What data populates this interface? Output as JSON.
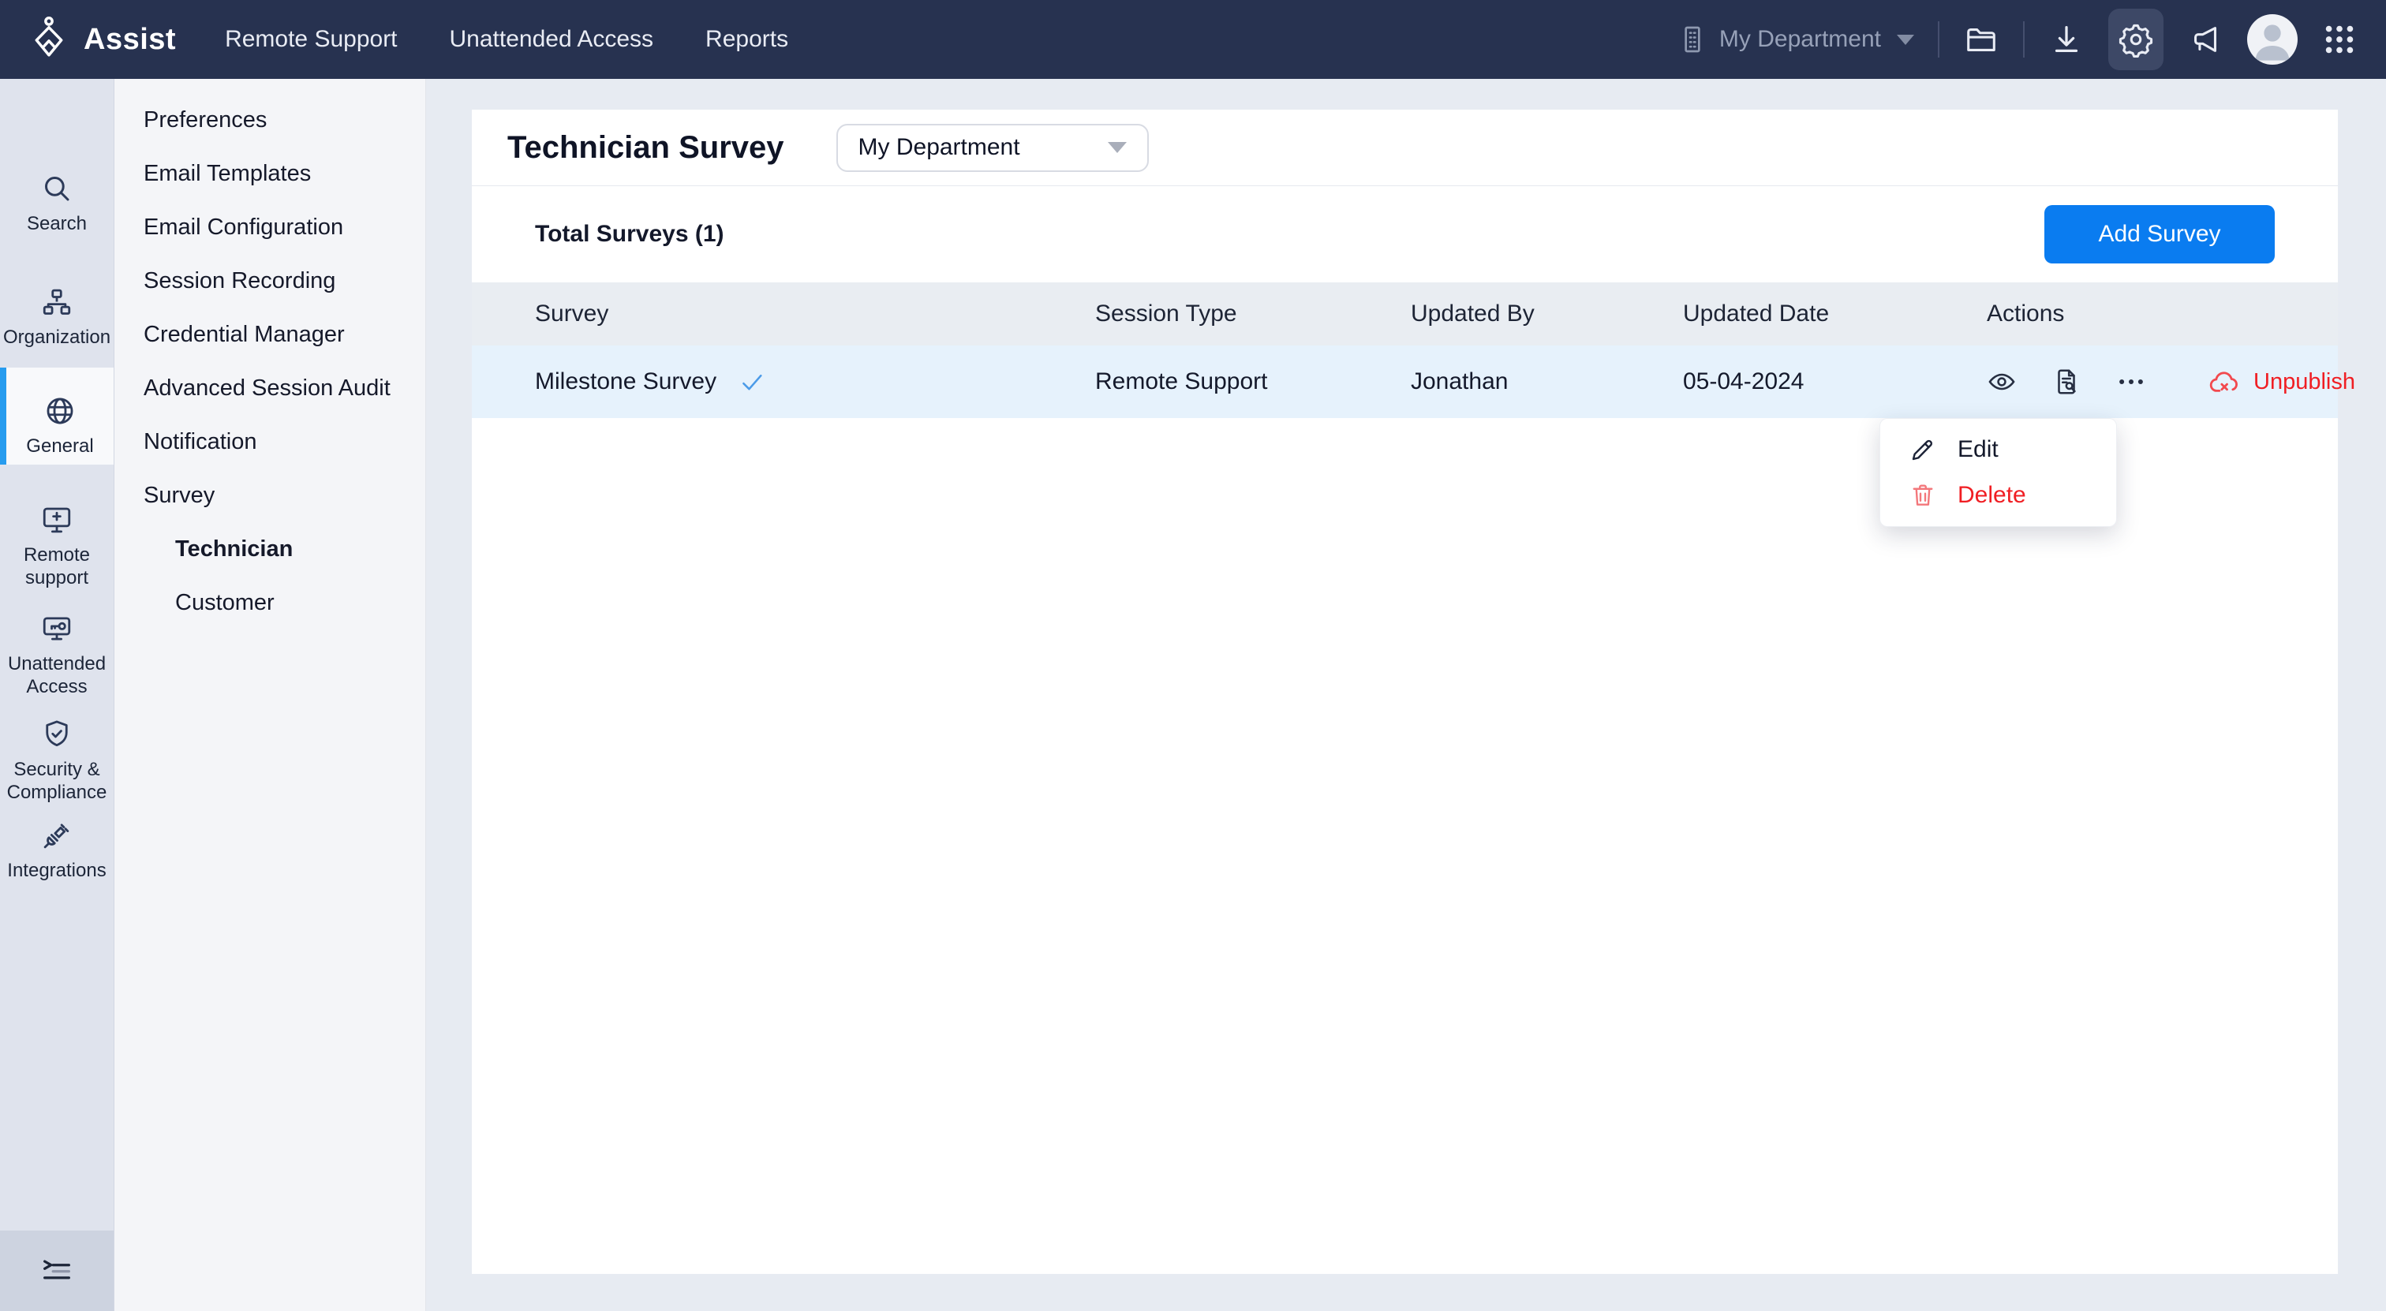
{
  "topbar": {
    "brand": "Assist",
    "nav": [
      {
        "label": "Remote Support"
      },
      {
        "label": "Unattended Access"
      },
      {
        "label": "Reports"
      }
    ],
    "department_selector": {
      "value": "My Department",
      "icon": "building-icon"
    },
    "icons": [
      "folder-icon",
      "download-icon",
      "settings-gear-icon",
      "announcement-icon",
      "avatar",
      "apps-grid-icon"
    ],
    "active_icon": "settings-gear-icon"
  },
  "rail": {
    "items": [
      {
        "label": "Search",
        "icon": "search-icon",
        "active": false
      },
      {
        "label": "Organization",
        "icon": "org-chart-icon",
        "active": false
      },
      {
        "label": "General",
        "icon": "globe-icon",
        "active": true
      },
      {
        "label": "Remote support",
        "icon": "monitor-plus-icon",
        "active": false
      },
      {
        "label": "Unattended Access",
        "icon": "monitor-key-icon",
        "active": false
      },
      {
        "label": "Security & Compliance",
        "icon": "shield-check-icon",
        "active": false
      },
      {
        "label": "Integrations",
        "icon": "plug-icon",
        "active": false
      }
    ],
    "bottom_icons": [
      "feedback-note-icon",
      "collapse-menu-icon"
    ]
  },
  "settings_menu": {
    "items": [
      {
        "label": "Preferences"
      },
      {
        "label": "Email Templates"
      },
      {
        "label": "Email Configuration"
      },
      {
        "label": "Session Recording"
      },
      {
        "label": "Credential Manager"
      },
      {
        "label": "Advanced Session Audit"
      },
      {
        "label": "Notification"
      },
      {
        "label": "Survey"
      }
    ],
    "sub_items": [
      {
        "label": "Technician",
        "active": true
      },
      {
        "label": "Customer",
        "active": false
      }
    ]
  },
  "main": {
    "title": "Technician Survey",
    "department_filter": {
      "value": "My Department"
    },
    "total_label": "Total Surveys (1)",
    "add_button": "Add Survey",
    "table": {
      "columns": [
        "Survey",
        "Session Type",
        "Updated By",
        "Updated Date",
        "Actions"
      ],
      "rows": [
        {
          "survey": "Milestone Survey",
          "published": true,
          "published_icon": "check-icon",
          "session_type": "Remote Support",
          "updated_by": "Jonathan",
          "updated_date": "05-04-2024",
          "action_icons": [
            "view-eye-icon",
            "report-document-icon",
            "more-ellipsis-icon"
          ],
          "unpublish_label": "Unpublish",
          "unpublish_icon": "cloud-unpublish-icon"
        }
      ]
    },
    "context_menu": {
      "items": [
        {
          "label": "Edit",
          "icon": "pencil-icon",
          "danger": false
        },
        {
          "label": "Delete",
          "icon": "trash-icon",
          "danger": true
        }
      ]
    }
  },
  "colors": {
    "topbar_bg": "#273250",
    "accent_blue": "#0A7CF0",
    "active_rail_bar": "#279CEF",
    "danger_red": "#F01E23",
    "row_highlight": "#E6F2FC",
    "table_header_bg": "#E9EDF2",
    "check_blue": "#4B9BE8"
  }
}
